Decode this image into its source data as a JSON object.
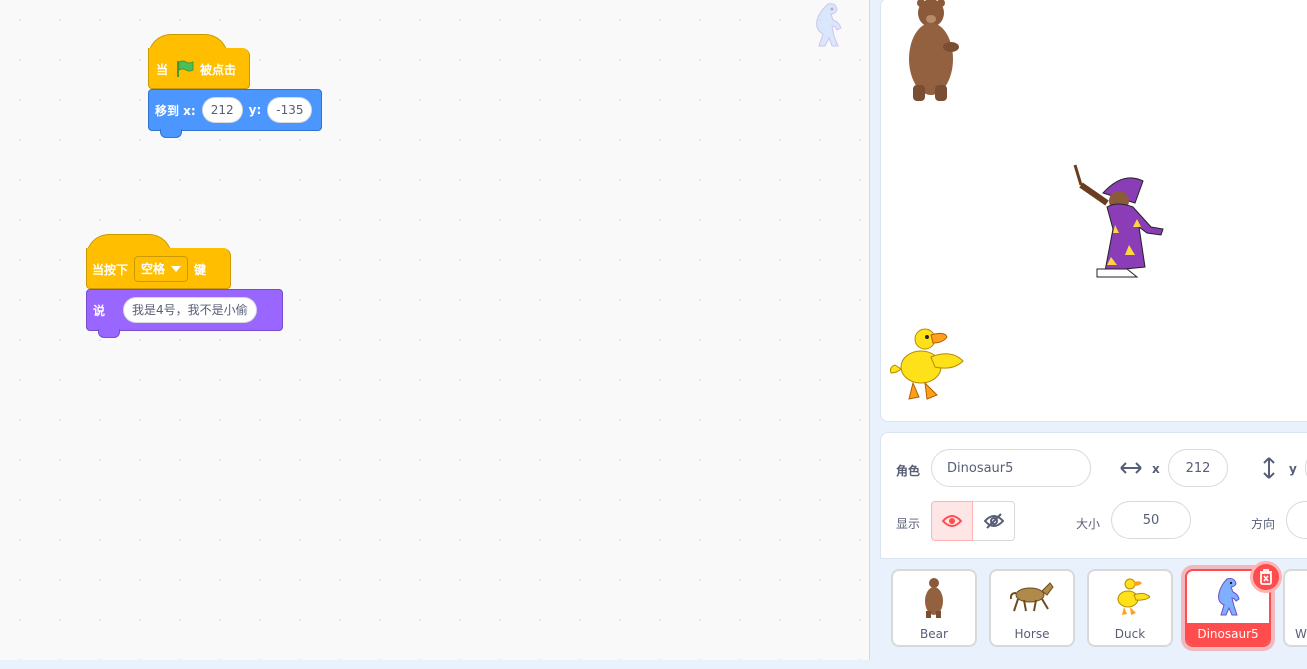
{
  "workspace": {
    "script1": {
      "hat_prefix": "当",
      "hat_suffix": "被点击",
      "move_label": "移到 x:",
      "x_value": "212",
      "y_label": "y:",
      "y_value": "-135"
    },
    "script2": {
      "hat_prefix": "当按下",
      "key_value": "空格",
      "hat_suffix": "键",
      "say_label": "说",
      "say_value": "我是4号，我不是小偷"
    }
  },
  "sprite_info": {
    "sprite_label": "角色",
    "sprite_name": "Dinosaur5",
    "x_label": "x",
    "x_value": "212",
    "y_label": "y",
    "show_label": "显示",
    "size_label": "大小",
    "size_value": "50",
    "direction_label": "方向"
  },
  "sprite_list": {
    "items": [
      {
        "name": "Bear"
      },
      {
        "name": "Horse"
      },
      {
        "name": "Duck"
      },
      {
        "name": "Dinosaur5"
      },
      {
        "name": "W"
      }
    ],
    "selected": "Dinosaur5"
  },
  "colors": {
    "events": "#ffbf00",
    "motion": "#4c97ff",
    "looks": "#9966ff",
    "selected": "#ff4c4c"
  }
}
